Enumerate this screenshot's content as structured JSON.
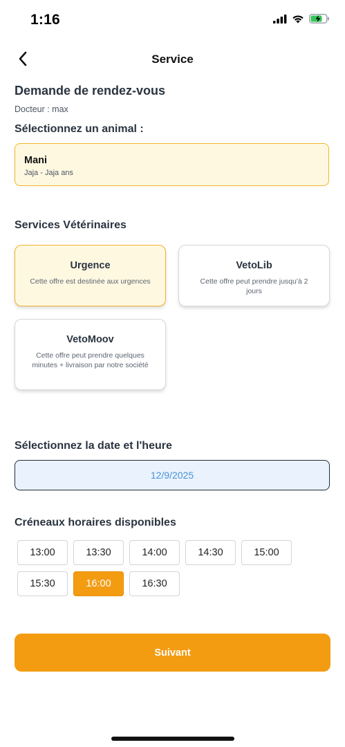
{
  "status_bar": {
    "time": "1:16"
  },
  "header": {
    "title": "Service"
  },
  "request": {
    "title": "Demande de rendez-vous",
    "doctor": "Docteur : max"
  },
  "animal_section": {
    "label": "Sélectionnez un animal :",
    "selected": {
      "name": "Mani",
      "detail": "Jaja - Jaja ans"
    }
  },
  "services": {
    "label": "Services Vétérinaires",
    "items": [
      {
        "title": "Urgence",
        "description": "Cette offre est destinée aux urgences",
        "selected": true
      },
      {
        "title": "VetoLib",
        "description": "Cette offre peut prendre jusqu'à 2 jours",
        "selected": false
      },
      {
        "title": "VetoMoov",
        "description": "Cette offre peut prendre quelques minutes + livraison par notre société",
        "selected": false
      }
    ]
  },
  "date_section": {
    "label": "Sélectionnez la date et l'heure",
    "value": "12/9/2025"
  },
  "slots_section": {
    "label": "Créneaux horaires disponibles",
    "slots": [
      "13:00",
      "13:30",
      "14:00",
      "14:30",
      "15:00",
      "15:30",
      "16:00",
      "16:30"
    ],
    "selected": "16:00"
  },
  "next_button": {
    "label": "Suivant"
  },
  "colors": {
    "accent": "#f39c12",
    "selected_bg": "#fff8e1",
    "date_text": "#4a90d9"
  },
  "icons": [
    "signal-icon",
    "wifi-icon",
    "battery-charging-icon",
    "chevron-left-icon"
  ]
}
